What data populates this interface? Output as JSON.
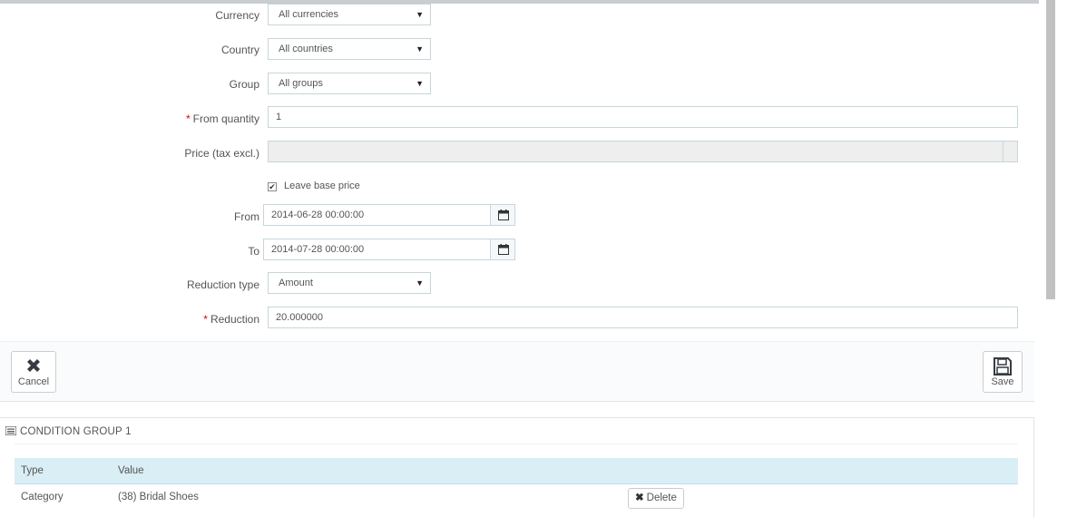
{
  "form": {
    "currency": {
      "label": "Currency",
      "value": "All currencies"
    },
    "country": {
      "label": "Country",
      "value": "All countries"
    },
    "group": {
      "label": "Group",
      "value": "All groups"
    },
    "from_quantity": {
      "required_mark": "*",
      "label": "From quantity",
      "value": "1"
    },
    "price": {
      "label": "Price (tax excl.)",
      "value": ""
    },
    "leave_base_price": {
      "label": "Leave base price",
      "checked": true
    },
    "from_date": {
      "label": "From",
      "value": "2014-06-28 00:00:00"
    },
    "to_date": {
      "label": "To",
      "value": "2014-07-28 00:00:00"
    },
    "reduction_type": {
      "label": "Reduction type",
      "value": "Amount"
    },
    "reduction": {
      "required_mark": "*",
      "label": "Reduction",
      "value": "20.000000"
    }
  },
  "footer": {
    "cancel_label": "Cancel",
    "save_label": "Save"
  },
  "condition_group": {
    "title": "CONDITION GROUP 1",
    "columns": [
      "Type",
      "Value"
    ],
    "rows": [
      {
        "type": "Category",
        "value": "(38) Bridal Shoes",
        "action": "Delete"
      }
    ]
  },
  "icons": [
    "caret-down-icon",
    "checkmark-icon",
    "calendar-icon",
    "close-icon",
    "save-icon",
    "list-icon"
  ]
}
